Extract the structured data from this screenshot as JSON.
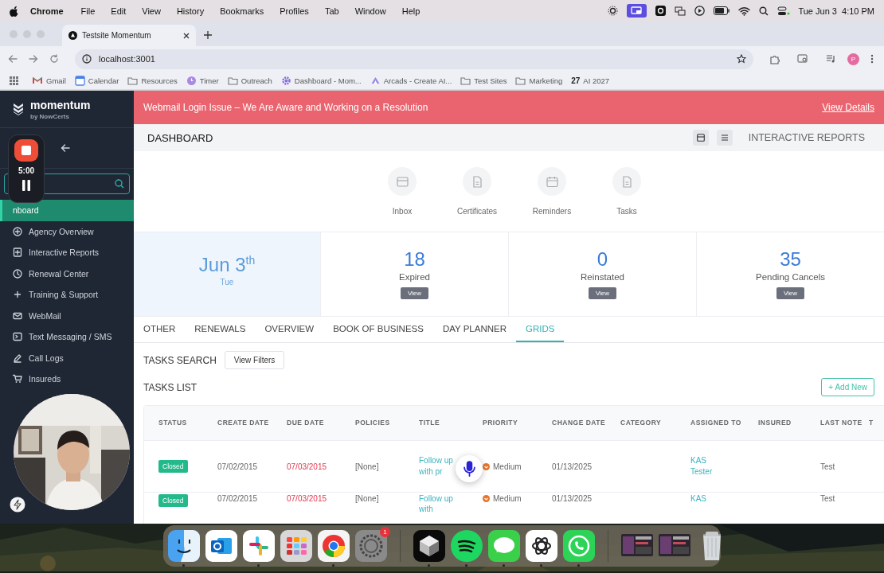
{
  "menubar": {
    "app": "Chrome",
    "menus": [
      "File",
      "Edit",
      "View",
      "History",
      "Bookmarks",
      "Profiles",
      "Tab",
      "Window",
      "Help"
    ],
    "clock": "Tue Jun 3  4:10 PM"
  },
  "browser": {
    "tab_title": "Testsite Momentum",
    "url": "localhost:3001",
    "profile_initial": "P",
    "bookmarks": [
      {
        "label": "Gmail",
        "kind": "mail"
      },
      {
        "label": "Calendar",
        "kind": "calendar"
      },
      {
        "label": "Resources",
        "kind": "folder"
      },
      {
        "label": "Timer",
        "kind": "timer"
      },
      {
        "label": "Outreach",
        "kind": "folder"
      },
      {
        "label": "Dashboard - Mom...",
        "kind": "gear"
      },
      {
        "label": "Arcads - Create AI...",
        "kind": "arcads"
      },
      {
        "label": "Test Sites",
        "kind": "folder"
      },
      {
        "label": "Marketing",
        "kind": "folder"
      },
      {
        "label": "AI 2027",
        "kind": "number",
        "icon_text": "27"
      }
    ]
  },
  "sidebar": {
    "brand": "momentum",
    "tagline": "by NowCerts",
    "items": [
      {
        "label": "nboard",
        "selected": true
      },
      {
        "label": "Agency Overview",
        "kind": "circle-plus",
        "selected": false
      },
      {
        "label": "Interactive Reports",
        "kind": "doc-plus",
        "selected": false
      },
      {
        "label": "Renewal Center",
        "kind": "clock",
        "selected": false
      },
      {
        "label": "Training & Support",
        "kind": "plus",
        "selected": false
      },
      {
        "label": "WebMail",
        "kind": "mail",
        "selected": false
      },
      {
        "label": "Text Messaging / SMS",
        "kind": "sms",
        "selected": false
      },
      {
        "label": "Call Logs",
        "kind": "pen",
        "selected": false
      },
      {
        "label": "Insureds",
        "kind": "cart",
        "selected": false
      }
    ]
  },
  "recorder": {
    "time": "5:00"
  },
  "banner": {
    "text": "Webmail Login Issue – We Are Aware and Working on a Resolution",
    "link": "View Details"
  },
  "header": {
    "title": "DASHBOARD",
    "reports": "INTERACTIVE REPORTS"
  },
  "shortcuts": [
    {
      "label": "Inbox",
      "kind": "inbox"
    },
    {
      "label": "Certificates",
      "kind": "doc"
    },
    {
      "label": "Reminders",
      "kind": "calendar"
    },
    {
      "label": "Tasks",
      "kind": "doc"
    }
  ],
  "date_card": {
    "date": "Jun 3$^{th}$",
    "weekday": "Tue"
  },
  "stats": [
    {
      "value": "18",
      "label": "Expired",
      "button": "View"
    },
    {
      "value": "0",
      "label": "Reinstated",
      "button": "View"
    },
    {
      "value": "35",
      "label": "Pending Cancels",
      "button": "View"
    }
  ],
  "tabs": [
    {
      "label": "OTHER",
      "selected": false
    },
    {
      "label": "RENEWALS",
      "selected": false
    },
    {
      "label": "OVERVIEW",
      "selected": false
    },
    {
      "label": "BOOK OF BUSINESS",
      "selected": false
    },
    {
      "label": "DAY PLANNER",
      "selected": false
    },
    {
      "label": "GRIDS",
      "selected": true
    }
  ],
  "tasks": {
    "search_label": "TASKS SEARCH",
    "filters_button": "View Filters",
    "list_title": "TASKS LIST",
    "add_button": "+ Add New",
    "columns": [
      "STATUS",
      "CREATE DATE",
      "DUE DATE",
      "POLICIES",
      "TITLE",
      "PRIORITY",
      "CHANGE DATE",
      "CATEGORY",
      "ASSIGNED TO",
      "INSURED",
      "LAST NOTE",
      "T"
    ],
    "rows": [
      {
        "status": "Closed",
        "create_date": "07/02/2015",
        "due_date": "07/03/2015",
        "overdue": true,
        "policies": "[None]",
        "title": "Follow up with pr",
        "priority": "Medium",
        "change_date": "01/13/2025",
        "assigned_to": "KAS Tester",
        "last_note": "Test"
      },
      {
        "status": "Closed",
        "create_date": "07/02/2015",
        "due_date": "07/03/2015",
        "overdue": true,
        "policies": "[None]",
        "title": "Follow up with",
        "priority": "Medium",
        "change_date": "01/13/2025",
        "assigned_to": "KAS",
        "last_note": "Test"
      }
    ]
  },
  "dock": [
    {
      "kind": "finder",
      "running": true
    },
    {
      "kind": "mail",
      "running": false
    },
    {
      "kind": "slack",
      "running": true
    },
    {
      "kind": "launchpad",
      "running": false
    },
    {
      "kind": "chrome",
      "running": true
    },
    {
      "kind": "settings",
      "running": false,
      "badge": "1"
    },
    {
      "kind": "cube",
      "running": true
    },
    {
      "kind": "music",
      "running": true
    },
    {
      "kind": "messages",
      "running": true
    },
    {
      "kind": "knot",
      "running": true
    },
    {
      "kind": "phone",
      "running": true
    },
    {
      "kind": "window",
      "running": false
    },
    {
      "kind": "window",
      "running": false
    },
    {
      "kind": "trash",
      "running": false
    }
  ]
}
